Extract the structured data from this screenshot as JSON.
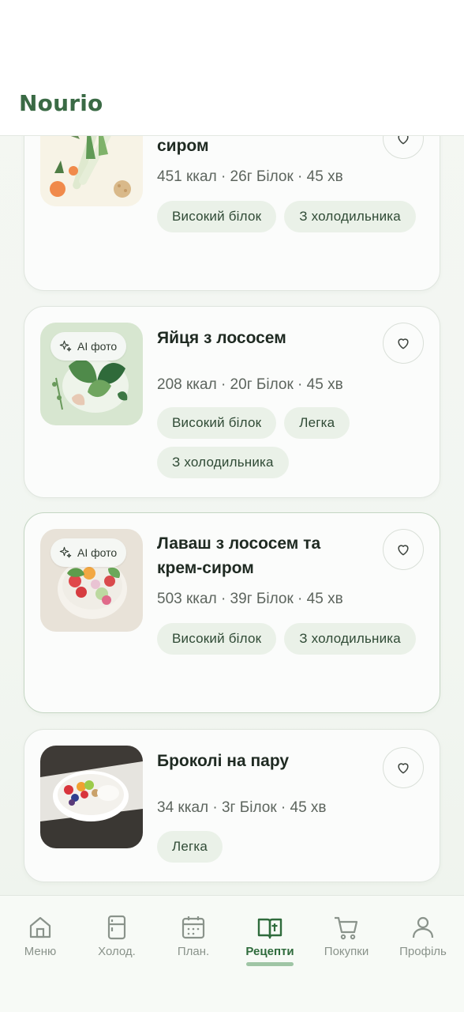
{
  "app": {
    "brand": "Nourio"
  },
  "recipes": [
    {
      "title": "сиром",
      "meta": "451 ккал · 26г Білок · 45 хв",
      "ai_photo": false,
      "tags": [
        "Високий білок",
        "З холодильника"
      ]
    },
    {
      "title": "Яйця з лососем",
      "meta": "208 ккал · 20г Білок · 45 хв",
      "ai_photo": true,
      "ai_label": "AI фото",
      "tags": [
        "Високий білок",
        "Легка",
        "З холодильника"
      ]
    },
    {
      "title": "Лаваш з лососем та крем-сиром",
      "meta": "503 ккал · 39г Білок · 45 хв",
      "ai_photo": true,
      "ai_label": "AI фото",
      "tags": [
        "Високий білок",
        "З холодильника"
      ]
    },
    {
      "title": "Броколі на пару",
      "meta": "34 ккал · 3г Білок · 45 хв",
      "ai_photo": false,
      "tags": [
        "Легка"
      ]
    }
  ],
  "tabbar": {
    "items": [
      {
        "label": "Меню",
        "icon": "home-icon",
        "active": false
      },
      {
        "label": "Холод.",
        "icon": "fridge-icon",
        "active": false
      },
      {
        "label": "План.",
        "icon": "calendar-icon",
        "active": false
      },
      {
        "label": "Рецепти",
        "icon": "recipe-book-icon",
        "active": true
      },
      {
        "label": "Покупки",
        "icon": "cart-icon",
        "active": false
      },
      {
        "label": "Профіль",
        "icon": "person-icon",
        "active": false
      }
    ]
  },
  "colors": {
    "brand": "#3a6a45",
    "tag_bg": "#eaf1e8",
    "active_tab": "#2f6b3c",
    "inactive_tab": "#8a938b"
  }
}
